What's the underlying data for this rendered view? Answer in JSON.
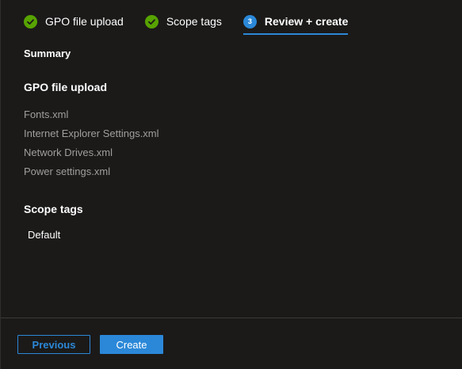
{
  "wizard": {
    "steps": [
      {
        "label": "GPO file upload",
        "state": "completed",
        "icon": "checkmark-icon"
      },
      {
        "label": "Scope tags",
        "state": "completed",
        "icon": "checkmark-icon"
      },
      {
        "label": "Review + create",
        "state": "active",
        "number": "3"
      }
    ]
  },
  "summary": {
    "title": "Summary",
    "gpo_section": {
      "title": "GPO file upload",
      "files": [
        "Fonts.xml",
        "Internet Explorer Settings.xml",
        "Network Drives.xml",
        "Power settings.xml"
      ]
    },
    "scope_section": {
      "title": "Scope tags",
      "value": "Default"
    }
  },
  "footer": {
    "previous_label": "Previous",
    "create_label": "Create"
  },
  "colors": {
    "background": "#1b1a19",
    "accent": "#2b88d8",
    "success": "#57a300",
    "muted_text": "#a19f9d"
  }
}
